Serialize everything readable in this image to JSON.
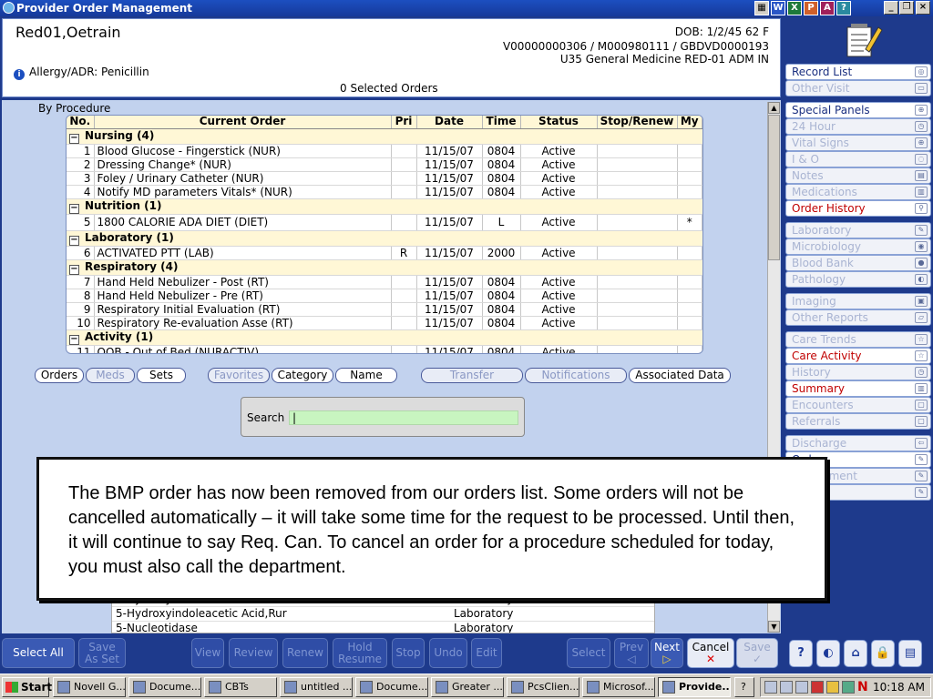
{
  "window": {
    "title": "Provider Order Management"
  },
  "titlebar_icons": [
    "W",
    "X",
    "P",
    "A",
    "?"
  ],
  "patient": {
    "name": "Red01,Oetrain",
    "dob": "DOB: 1/2/45 62 F",
    "ids": "V00000000306 / M000980111 / GBDVD0000193",
    "location": "U35 General Medicine RED-01  ADM IN",
    "allergy": "Allergy/ADR: Penicillin",
    "selected_orders": "0 Selected Orders"
  },
  "sidebar": {
    "groups": [
      [
        {
          "label": "Record List",
          "state": "normal"
        },
        {
          "label": "Other Visit",
          "state": "disabled"
        }
      ],
      [
        {
          "label": "Special Panels",
          "state": "normal"
        },
        {
          "label": "24 Hour",
          "state": "disabled"
        },
        {
          "label": "Vital Signs",
          "state": "disabled"
        },
        {
          "label": "I & O",
          "state": "disabled"
        },
        {
          "label": "Notes",
          "state": "disabled"
        },
        {
          "label": "Medications",
          "state": "disabled"
        },
        {
          "label": "Order History",
          "state": "red"
        }
      ],
      [
        {
          "label": "Laboratory",
          "state": "disabled"
        },
        {
          "label": "Microbiology",
          "state": "disabled"
        },
        {
          "label": "Blood Bank",
          "state": "disabled"
        },
        {
          "label": "Pathology",
          "state": "disabled"
        }
      ],
      [
        {
          "label": "Imaging",
          "state": "disabled"
        },
        {
          "label": "Other Reports",
          "state": "disabled"
        }
      ],
      [
        {
          "label": "Care Trends",
          "state": "disabled"
        },
        {
          "label": "Care Activity",
          "state": "red"
        },
        {
          "label": "History",
          "state": "disabled"
        },
        {
          "label": "Summary",
          "state": "red"
        },
        {
          "label": "Encounters",
          "state": "disabled"
        },
        {
          "label": "Referrals",
          "state": "disabled"
        }
      ],
      [
        {
          "label": "Discharge",
          "state": "disabled"
        },
        {
          "label": "Orders",
          "state": "normal"
        },
        {
          "label": "Assessment",
          "state": "disabled"
        },
        {
          "label": "",
          "state": "disabled"
        }
      ]
    ]
  },
  "orders": {
    "view_label": "By Procedure",
    "columns": [
      "No.",
      "Current Order",
      "Pri",
      "Date",
      "Time",
      "Status",
      "Stop/Renew",
      "My"
    ],
    "groups": [
      {
        "name": "Nursing   (4)",
        "rows": [
          {
            "no": "1",
            "order": "Blood Glucose - Fingerstick (NUR)",
            "pri": "",
            "date": "11/15/07",
            "time": "0804",
            "status": "Active",
            "stop": "",
            "my": ""
          },
          {
            "no": "2",
            "order": "Dressing Change* (NUR)",
            "pri": "",
            "date": "11/15/07",
            "time": "0804",
            "status": "Active",
            "stop": "",
            "my": ""
          },
          {
            "no": "3",
            "order": "Foley / Urinary Catheter (NUR)",
            "pri": "",
            "date": "11/15/07",
            "time": "0804",
            "status": "Active",
            "stop": "",
            "my": ""
          },
          {
            "no": "4",
            "order": "Notify MD parameters Vitals* (NUR)",
            "pri": "",
            "date": "11/15/07",
            "time": "0804",
            "status": "Active",
            "stop": "",
            "my": ""
          }
        ]
      },
      {
        "name": "Nutrition   (1)",
        "rows": [
          {
            "no": "5",
            "order": "1800 CALORIE ADA DIET (DIET)",
            "pri": "",
            "date": "11/15/07",
            "time": "L",
            "status": "Active",
            "stop": "",
            "my": "*"
          }
        ]
      },
      {
        "name": "Laboratory   (1)",
        "rows": [
          {
            "no": "6",
            "order": "ACTIVATED PTT (LAB)",
            "pri": "R",
            "date": "11/15/07",
            "time": "2000",
            "status": "Active",
            "stop": "",
            "my": ""
          }
        ]
      },
      {
        "name": "Respiratory   (4)",
        "rows": [
          {
            "no": "7",
            "order": "Hand Held Nebulizer - Post (RT)",
            "pri": "",
            "date": "11/15/07",
            "time": "0804",
            "status": "Active",
            "stop": "",
            "my": ""
          },
          {
            "no": "8",
            "order": "Hand Held Nebulizer - Pre (RT)",
            "pri": "",
            "date": "11/15/07",
            "time": "0804",
            "status": "Active",
            "stop": "",
            "my": ""
          },
          {
            "no": "9",
            "order": "Respiratory Initial Evaluation (RT)",
            "pri": "",
            "date": "11/15/07",
            "time": "0804",
            "status": "Active",
            "stop": "",
            "my": ""
          },
          {
            "no": "10",
            "order": "Respiratory Re-evaluation Asse (RT)",
            "pri": "",
            "date": "11/15/07",
            "time": "0804",
            "status": "Active",
            "stop": "",
            "my": ""
          }
        ]
      },
      {
        "name": "Activity   (1)",
        "rows": [
          {
            "no": "11",
            "order": "OOB - Out of Bed (NURACTIV)",
            "pri": "",
            "date": "11/15/07",
            "time": "0804",
            "status": "Active",
            "stop": "",
            "my": ""
          }
        ]
      }
    ]
  },
  "tabs": [
    {
      "label": "Orders",
      "state": "normal"
    },
    {
      "label": "Meds",
      "state": "disabled"
    },
    {
      "label": "Sets",
      "state": "normal"
    },
    {
      "label": "Favorites",
      "state": "disabled"
    },
    {
      "label": "Category",
      "state": "normal"
    },
    {
      "label": "Name",
      "state": "normal"
    },
    {
      "label": "Transfer",
      "state": "disabled"
    },
    {
      "label": "Notifications",
      "state": "disabled"
    },
    {
      "label": "Associated Data",
      "state": "normal"
    }
  ],
  "search": {
    "label": "Search",
    "value": ""
  },
  "lower_list": [
    {
      "name": "5-Hydroxyindoleacetic Acid 24 Hr",
      "category": "Laboratory"
    },
    {
      "name": "5-Hydroxyindoleacetic Acid,Rur",
      "category": "Laboratory"
    },
    {
      "name": "5-Nucleotidase",
      "category": "Laboratory"
    }
  ],
  "overlay_text": "The BMP order has now been removed from our orders list. Some orders will not be cancelled automatically – it will take some time for the request to be processed. Until then, it will continue to say Req. Can. To cancel an order for a procedure scheduled for today, you must also call the department.",
  "bottom_buttons": {
    "select_all": "Select All",
    "save_as_set": [
      "Save",
      "As Set"
    ],
    "view": "View",
    "review": "Review",
    "renew": "Renew",
    "hold_resume": [
      "Hold",
      "Resume"
    ],
    "stop": "Stop",
    "undo": "Undo",
    "edit": "Edit",
    "select": "Select",
    "prev": "Prev",
    "next": "Next",
    "cancel": "Cancel",
    "save": "Save",
    "help": "?"
  },
  "taskbar": {
    "start": "Start",
    "items": [
      {
        "label": "Novell G...",
        "active": false
      },
      {
        "label": "Docume...",
        "active": false
      },
      {
        "label": "CBTs",
        "active": false
      },
      {
        "label": "untitled ...",
        "active": false
      },
      {
        "label": "Docume...",
        "active": false
      },
      {
        "label": "Greater ...",
        "active": false
      },
      {
        "label": "PcsClien...",
        "active": false
      },
      {
        "label": "Microsof...",
        "active": false
      },
      {
        "label": "Provide...",
        "active": true
      }
    ],
    "clock": "10:18 AM"
  }
}
